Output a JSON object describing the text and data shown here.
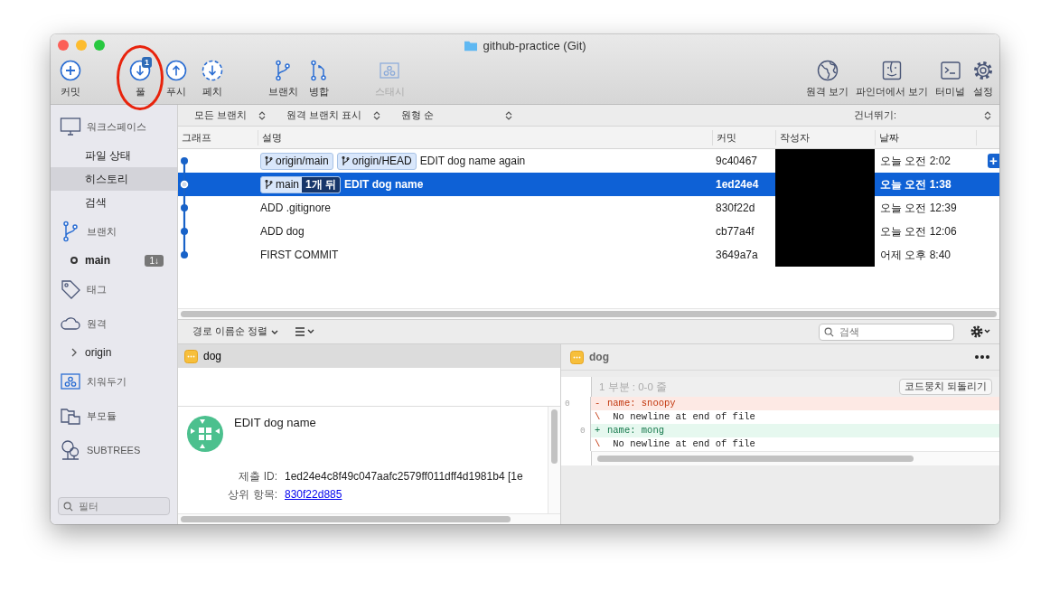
{
  "window": {
    "title": "github-practice (Git)"
  },
  "toolbar": {
    "groups": [
      [
        {
          "kind": "commit",
          "label": "커밋",
          "disabled": false,
          "highlighted": false
        }
      ],
      [
        {
          "kind": "pull",
          "label": "풀",
          "badge": "1",
          "disabled": false,
          "highlighted": true
        },
        {
          "kind": "push",
          "label": "푸시",
          "disabled": false,
          "highlighted": false
        },
        {
          "kind": "fetch",
          "label": "페치",
          "disabled": false,
          "highlighted": false
        }
      ],
      [
        {
          "kind": "branch",
          "label": "브랜치",
          "disabled": false,
          "highlighted": false
        },
        {
          "kind": "merge",
          "label": "병합",
          "disabled": false,
          "highlighted": false
        }
      ],
      [
        {
          "kind": "stash",
          "label": "스태시",
          "disabled": true,
          "highlighted": false
        }
      ]
    ],
    "right": [
      {
        "kind": "globe",
        "label": "원격 보기"
      },
      {
        "kind": "finder",
        "label": "파인더에서 보기"
      },
      {
        "kind": "terminal",
        "label": "터미널"
      },
      {
        "kind": "gear",
        "label": "설정"
      }
    ]
  },
  "sidebar": {
    "sections": [
      {
        "kind": "monitor",
        "title": "워크스페이스",
        "items": [
          {
            "kind": "view",
            "label": "파일 상태",
            "selected": false
          },
          {
            "kind": "view",
            "label": "히스토리",
            "selected": true
          },
          {
            "kind": "view",
            "label": "검색",
            "selected": false
          }
        ]
      },
      {
        "kind": "branch",
        "title": "브랜치",
        "items": [
          {
            "kind": "branch",
            "label": "main",
            "selected": false,
            "badge": "1↓"
          }
        ]
      },
      {
        "kind": "tag",
        "title": "태그"
      },
      {
        "kind": "cloud",
        "title": "원격",
        "items": [
          {
            "kind": "remote",
            "label": "origin",
            "selected": false,
            "expanded": false
          }
        ]
      },
      {
        "kind": "stash",
        "title": "치워두기"
      },
      {
        "kind": "folder",
        "title": "부모듈"
      },
      {
        "kind": "tree",
        "title": "SUBTREES"
      }
    ],
    "filter": {
      "placeholder": "필터"
    }
  },
  "filter_bar": {
    "dropdowns": [
      "모든 브랜치",
      "원격 브랜치 표시",
      "원형 순"
    ],
    "jump": "건너뛰기:"
  },
  "table": {
    "columns": [
      "그래프",
      "설명",
      "커밋",
      "작성자",
      "날짜"
    ],
    "rows": [
      {
        "selected": false,
        "refs": [
          {
            "label": "origin/main"
          },
          {
            "label": "origin/HEAD"
          }
        ],
        "message": "EDIT dog name again",
        "commit": "9c40467",
        "author_redacted": true,
        "date": "오늘 오전 2:02",
        "action": "+"
      },
      {
        "selected": true,
        "refs": [
          {
            "label": "main",
            "tracking": "1개 뒤"
          }
        ],
        "message": "EDIT dog name",
        "commit": "1ed24e4",
        "author_redacted": true,
        "date": "오늘 오전 1:38"
      },
      {
        "selected": false,
        "message": "ADD .gitignore",
        "commit": "830f22d",
        "author_redacted": true,
        "date": "오늘 오전 12:39"
      },
      {
        "selected": false,
        "message": "ADD dog",
        "commit": "cb77a4f",
        "author_redacted": true,
        "date": "오늘 오전 12:06"
      },
      {
        "selected": false,
        "message": "FIRST COMMIT",
        "commit": "3649a7a",
        "author_redacted": true,
        "date": "어제 오후 8:40"
      }
    ]
  },
  "lower_toolbar": {
    "sort": "경로 이름순 정렬",
    "search": {
      "placeholder": "검색"
    }
  },
  "files": [
    {
      "name": "dog",
      "selected": true
    }
  ],
  "commit_details": {
    "subject": "EDIT dog name",
    "fields": [
      {
        "kind": "text",
        "label": "제출 ID:",
        "value": "1ed24e4c8f49c047aafc2579ff011dff4d1981b4 [1e"
      },
      {
        "kind": "link",
        "label": "상위 항목:",
        "value": "830f22d885"
      }
    ]
  },
  "diff": {
    "file": "dog",
    "hunk": "1 부분 : 0-0 줄",
    "discard": "코드뭉치 되돌리기",
    "lines": [
      {
        "kind": "removed",
        "old": "0",
        "sign": "-",
        "text": "name: snoopy"
      },
      {
        "kind": "note",
        "sign": "\\",
        "text": " No newline at end of file"
      },
      {
        "kind": "added",
        "new": "0",
        "sign": "+",
        "text": "name: mong"
      },
      {
        "kind": "note",
        "sign": "\\",
        "text": " No newline at end of file"
      }
    ]
  }
}
